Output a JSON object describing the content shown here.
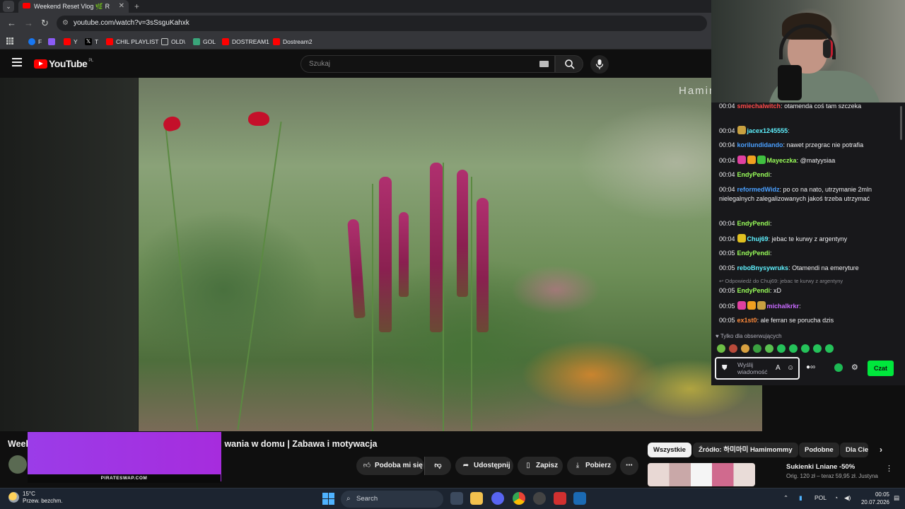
{
  "browser": {
    "tab_title": "Weekend Reset Vlog 🌿 R",
    "url": "youtube.com/watch?v=3sSsguKahxk",
    "bookmarks": [
      {
        "label": "F",
        "color": "#1877f2"
      },
      {
        "label": "",
        "color": "#8b5cf6"
      },
      {
        "label": "Y",
        "color": "#ff0000"
      },
      {
        "label": "T",
        "color": "#000000"
      },
      {
        "label": "CHIL PLAYLIST",
        "color": "#ff0000"
      },
      {
        "label": "OLD\\",
        "color": "#35363a"
      },
      {
        "label": "GOL",
        "color": "#3aa57a"
      },
      {
        "label": "DOSTREAM1",
        "color": "#ff0000"
      },
      {
        "label": "Dostream2",
        "color": "#ff0000"
      }
    ]
  },
  "youtube": {
    "logo_text": "YouTube",
    "region": "PL",
    "search_placeholder": "Szukaj",
    "video_watermark": "Hamin",
    "title_start": "Week",
    "title_end": "wania w domu | Zabawa i motywacja",
    "overlay_caption": "PIRATESWAP.COM",
    "actions": {
      "like": "Podoba mi się",
      "share": "Udostępnij",
      "save": "Zapisz",
      "download": "Pobierz",
      "more": "⋯"
    },
    "chips": [
      "Wszystkie",
      "Źródło: 하미마미 Hamimommy",
      "Podobne",
      "Dla Cie"
    ],
    "recommendation": {
      "title": "Sukienki Lniane -50%",
      "subtitle": "Orig. 120 zł – teraz 59,95 zł. Justyna"
    }
  },
  "chat": {
    "messages": [
      {
        "time": "00:04",
        "user": "smiechalwitch",
        "color": "#ff4a4a",
        "text": ": otamenda coś tam szczeka",
        "emotes": []
      },
      {
        "time": "00:04",
        "user": "jacex1245555",
        "color": "#5ff2ff",
        "text": ":",
        "emotes": [
          "#c8a040"
        ]
      },
      {
        "time": "00:04",
        "user": "korilundidando",
        "color": "#4aa0ff",
        "text": ": nawet przegrac nie potrafia",
        "emotes": []
      },
      {
        "time": "00:04",
        "user": "Mayeczka",
        "color": "#9aff5a",
        "text": ": @matyysiaa",
        "emotes": [
          "#e040a0",
          "#f0a020",
          "#40c040"
        ]
      },
      {
        "time": "00:04",
        "user": "EndyPendi",
        "color": "#9aff5a",
        "text": ":",
        "emotes": []
      },
      {
        "time": "00:04",
        "user": "reformedWidz",
        "color": "#4aa0ff",
        "text": ": po co na nato, utrzymanie 2mln",
        "emotes": []
      },
      {
        "time": "",
        "user": "",
        "color": "#efeff1",
        "text": "nielegalnych zalegalizowanych jakoś trzeba utrzymać",
        "emotes": []
      },
      {
        "time": "00:04",
        "user": "EndyPendi",
        "color": "#9aff5a",
        "text": ":",
        "emotes": []
      },
      {
        "time": "00:04",
        "user": "Chuj69",
        "color": "#5ff2ff",
        "text": ": jebac te kurwy z argentyny",
        "emotes": [
          "#e0c020"
        ]
      },
      {
        "time": "00:05",
        "user": "EndyPendi",
        "color": "#9aff5a",
        "text": ":",
        "emotes": []
      },
      {
        "time": "00:05",
        "user": "reboBnysywruks",
        "color": "#5ff2ff",
        "text": ": Otamendi na emeryture",
        "emotes": []
      },
      {
        "time": "00:05",
        "user": "EndyPendi",
        "color": "#9aff5a",
        "text": ": xD",
        "emotes": []
      },
      {
        "time": "00:05",
        "user": "michalkrkr",
        "color": "#c86aff",
        "text": ":",
        "emotes": [
          "#e040a0",
          "#f0a020",
          "#c8a040"
        ]
      },
      {
        "time": "00:05",
        "user": "ex1st0",
        "color": "#ff8a3a",
        "text": ": ale ferran se porucha dzis",
        "emotes": []
      }
    ],
    "reply_note": "↩ Odpowiedź do Chuj69: jebac te kurwy z argentyny",
    "follow_note": "♥ Tylko dla obserwujących",
    "input_placeholder": "Wyślij wiadomość",
    "send_label": "Czat"
  },
  "taskbar": {
    "temperature": "15°C",
    "weather": "Przew. bezchm.",
    "search_placeholder": "Search",
    "language": "POL",
    "time": "00:05",
    "date": "20.07.2026"
  }
}
